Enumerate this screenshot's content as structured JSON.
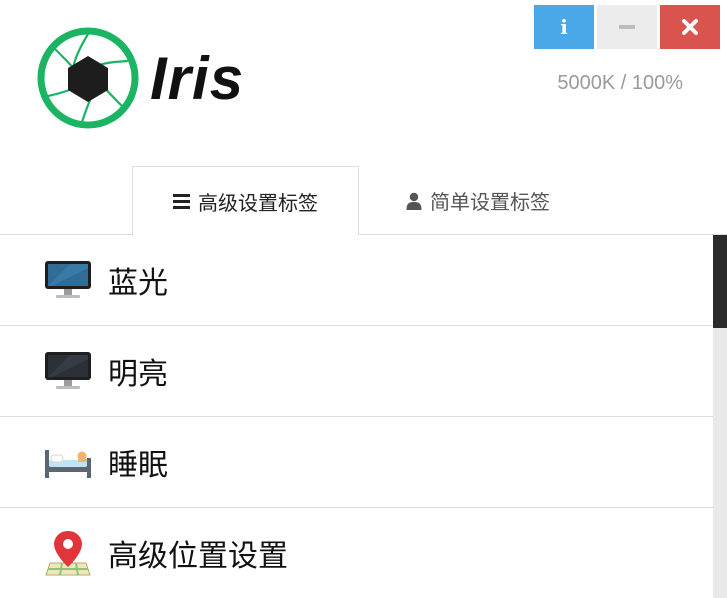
{
  "window": {
    "info_label": "i",
    "close_label": "✖"
  },
  "app": {
    "name": "Iris",
    "status": "5000K / 100%"
  },
  "tabs": [
    {
      "label": "高级设置标签",
      "icon": "menu-icon",
      "active": true
    },
    {
      "label": "简单设置标签",
      "icon": "user-icon",
      "active": false
    }
  ],
  "items": [
    {
      "label": "蓝光",
      "icon": "monitor-blue-icon"
    },
    {
      "label": "明亮",
      "icon": "monitor-dark-icon"
    },
    {
      "label": "睡眠",
      "icon": "bed-icon"
    },
    {
      "label": "高级位置设置",
      "icon": "map-pin-icon"
    }
  ],
  "colors": {
    "info": "#4aa8e8",
    "minimize": "#ececec",
    "close": "#d9534f",
    "logo_green": "#1bb463"
  }
}
